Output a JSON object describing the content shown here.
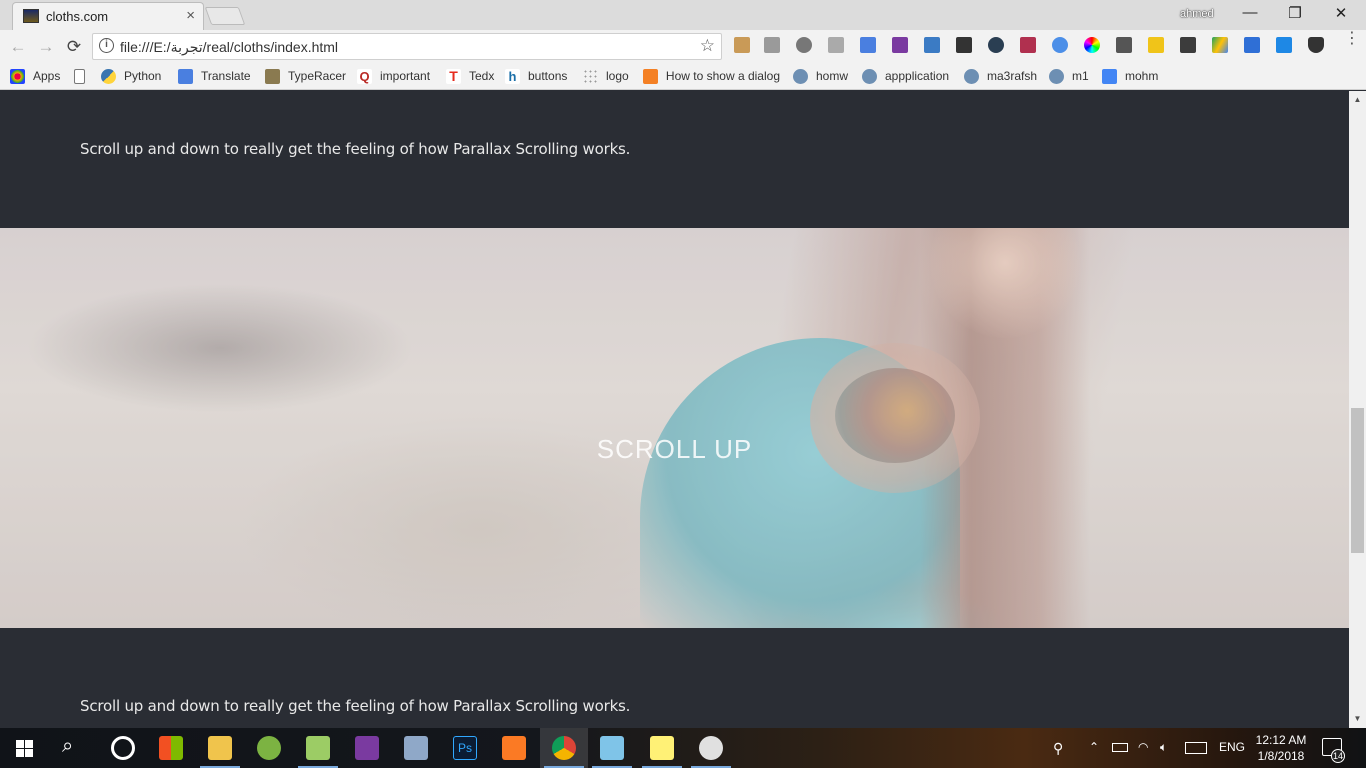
{
  "browser": {
    "tab_title": "cloths.com",
    "tab_close": "×",
    "user_name": "ahmed",
    "window_controls": {
      "minimize": "—",
      "restore": "❐",
      "close": "✕"
    },
    "nav": {
      "back": "←",
      "forward": "→",
      "reload": "⟳"
    },
    "address_bar": {
      "url": "file:///E:/تجربة/real/cloths/index.html",
      "info_icon": "i",
      "star": "☆"
    },
    "menu": "⋮",
    "extensions": [
      "tag-icon",
      "camera-icon",
      "bulb-icon",
      "dropbox-icon",
      "google-translate-icon",
      "onenote-icon",
      "new-badge-icon",
      "film-icon",
      "speed-icon",
      "palette-icon",
      "download-icon",
      "color-wheel-icon",
      "eyedropper-icon",
      "m-icon",
      "evernote-icon",
      "drive-icon",
      "window-icon",
      "s-icon",
      "shield-icon"
    ],
    "bookmarks": [
      {
        "label": "Apps",
        "icon": "apps-grid-icon"
      },
      {
        "label": "",
        "icon": "page-icon"
      },
      {
        "label": "Python",
        "icon": "python-icon"
      },
      {
        "label": "Translate",
        "icon": "translate-icon"
      },
      {
        "label": "TypeRacer",
        "icon": "typeracer-icon"
      },
      {
        "label": "important",
        "icon": "quora-icon"
      },
      {
        "label": "Tedx",
        "icon": "tedx-icon"
      },
      {
        "label": "buttons",
        "icon": "hm-icon"
      },
      {
        "label": "logo",
        "icon": "grid-dots-icon"
      },
      {
        "label": "How to show a dialog",
        "icon": "stackoverflow-icon"
      },
      {
        "label": "homw",
        "icon": "uwc-icon"
      },
      {
        "label": "appplication",
        "icon": "uwc-icon"
      },
      {
        "label": "ma3rafsh",
        "icon": "uwc-icon"
      },
      {
        "label": "m1",
        "icon": "uwc-icon"
      },
      {
        "label": "mohm",
        "icon": "doc-icon"
      }
    ]
  },
  "page": {
    "text_top": "Scroll up and down to really get the feeling of how Parallax Scrolling works.",
    "parallax_caption": "SCROLL UP",
    "text_bottom": "Scroll up and down to really get the feeling of how Parallax Scrolling works."
  },
  "scrollbar": {
    "up": "▲",
    "down": "▼",
    "position_fraction": 0.5
  },
  "taskbar": {
    "start": "windows-icon",
    "search": "⌕",
    "apps": [
      "cortana-icon",
      "store-icon",
      "file-explorer-icon",
      "android-studio-icon",
      "notepad-plus-icon",
      "onenote-icon",
      "control-panel-icon",
      "photoshop-icon",
      "xampp-icon",
      "chrome-icon",
      "paint3d-icon",
      "sticky-notes-icon",
      "paint-icon"
    ],
    "tray": {
      "language": "ENG",
      "time": "12:12 AM",
      "date": "1/8/2018",
      "notifications": "14"
    }
  }
}
